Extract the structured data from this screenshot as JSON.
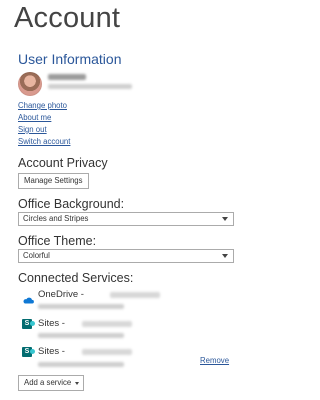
{
  "page": {
    "title": "Account"
  },
  "user_information": {
    "heading": "User Information",
    "links": [
      "Change photo",
      "About me",
      "Sign out",
      "Switch account"
    ]
  },
  "account_privacy": {
    "heading": "Account Privacy",
    "button_label": "Manage Settings"
  },
  "office_background": {
    "heading": "Office Background:",
    "selected": "Circles and Stripes"
  },
  "office_theme": {
    "heading": "Office Theme:",
    "selected": "Colorful"
  },
  "connected_services": {
    "heading": "Connected Services:",
    "services": [
      {
        "name": "OneDrive - ",
        "icon": "onedrive-cloud-icon"
      },
      {
        "name": "Sites - ",
        "icon": "sharepoint-icon"
      },
      {
        "name": "Sites - ",
        "icon": "sharepoint-icon"
      }
    ],
    "remove_label": "Remove",
    "add_service_label": "Add a service"
  },
  "colors": {
    "accent": "#2b579a",
    "onedrive": "#0f78d4",
    "sharepoint": "#036c70"
  }
}
